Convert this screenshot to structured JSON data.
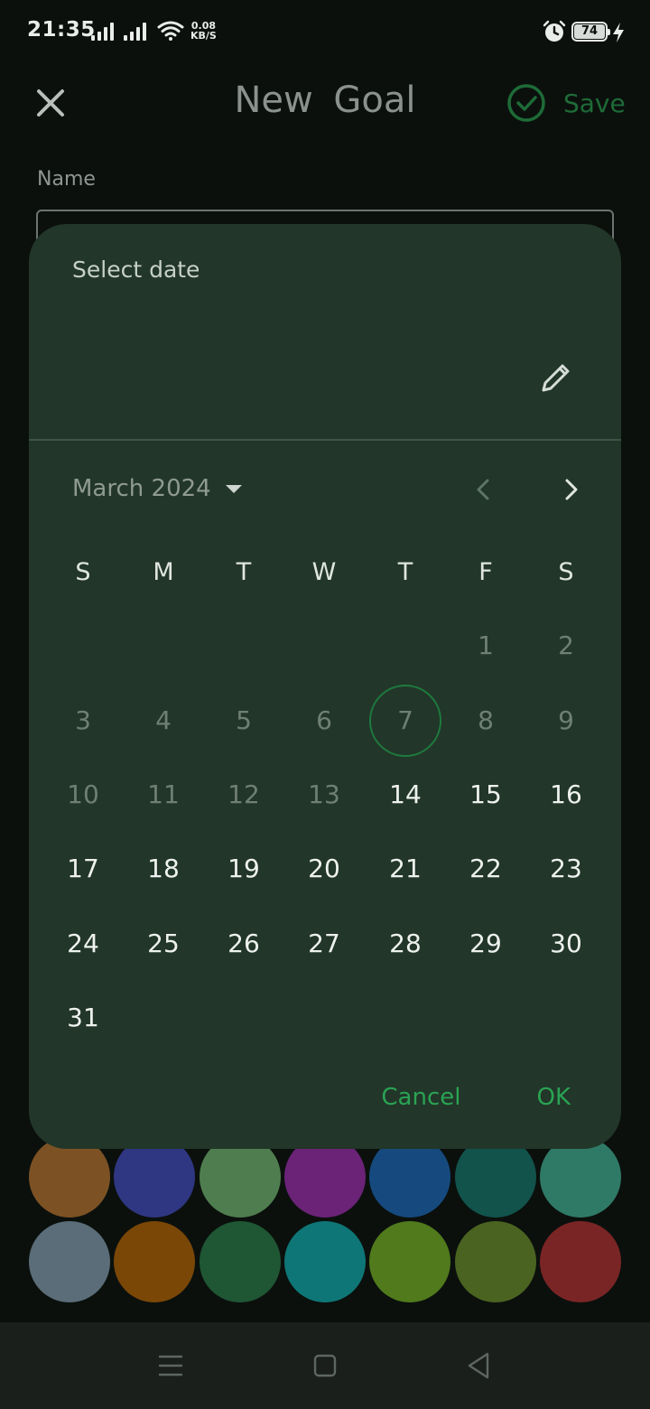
{
  "status_bar": {
    "time": "21:35",
    "net_speed_value": "0.08",
    "net_speed_unit": "KB/S",
    "battery": "74",
    "icons": [
      "signal-icon",
      "signal-icon",
      "wifi-icon",
      "alarm-icon",
      "battery-icon",
      "charging-icon"
    ]
  },
  "app_bar": {
    "title": "New  Goal",
    "save_label": "Save",
    "close_icon": "close-icon",
    "save_icon": "check-circle-icon"
  },
  "form": {
    "name_label": "Name",
    "name_value": ""
  },
  "colors": {
    "swatches_row1": [
      "#7c5224",
      "#2f3782",
      "#4f7d4f",
      "#6a2377",
      "#164a7e",
      "#12534c",
      "#2f7a66"
    ],
    "swatches_row2": [
      "#5a6d78",
      "#7a4707",
      "#1f5634",
      "#0e7676",
      "#507a1c",
      "#4a6320",
      "#7a2525"
    ],
    "accent": "#2aa354",
    "dialog_bg": "#223629"
  },
  "date_picker": {
    "header_label": "Select date",
    "edit_icon": "pencil-icon",
    "month_label": "March 2024",
    "weekdays": [
      "S",
      "M",
      "T",
      "W",
      "T",
      "F",
      "S"
    ],
    "days": [
      "1",
      "2",
      "3",
      "4",
      "5",
      "6",
      "7",
      "8",
      "9",
      "10",
      "11",
      "12",
      "13",
      "14",
      "15",
      "16",
      "17",
      "18",
      "19",
      "20",
      "21",
      "22",
      "23",
      "24",
      "25",
      "26",
      "27",
      "28",
      "29",
      "30",
      "31"
    ],
    "first_weekday_index": 5,
    "today": "7",
    "first_enabled_day": 14,
    "cancel_label": "Cancel",
    "ok_label": "OK"
  },
  "nav_bar": {
    "icons": [
      "menu-icon",
      "home-icon",
      "back-icon"
    ]
  }
}
